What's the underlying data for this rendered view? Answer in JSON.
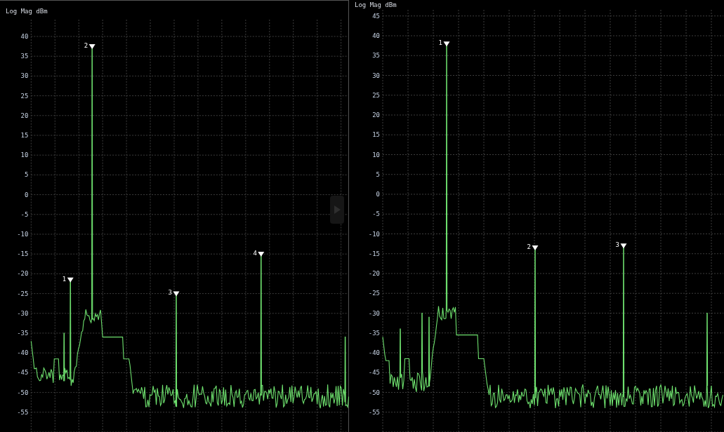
{
  "panels": [
    {
      "title": "Log Mag dBm",
      "yticks": [
        "40",
        "35",
        "30",
        "25",
        "20",
        "15",
        "10",
        "5",
        "0",
        "-5",
        "-10",
        "-15",
        "-20",
        "-25",
        "-30",
        "-35",
        "-40",
        "-45",
        "-50",
        "-55"
      ],
      "markers": [
        {
          "label": "1"
        },
        {
          "label": "2"
        },
        {
          "label": "3"
        },
        {
          "label": "4"
        }
      ],
      "play_button": true
    },
    {
      "title": "Log Mag dBm",
      "yticks": [
        "45",
        "40",
        "35",
        "30",
        "25",
        "20",
        "15",
        "10",
        "5",
        "0",
        "-5",
        "-10",
        "-15",
        "-20",
        "-25",
        "-30",
        "-35",
        "-40",
        "-45",
        "-50",
        "-55"
      ],
      "markers": [
        {
          "label": "1"
        },
        {
          "label": "2"
        },
        {
          "label": "3"
        }
      ],
      "play_button": false
    }
  ]
}
